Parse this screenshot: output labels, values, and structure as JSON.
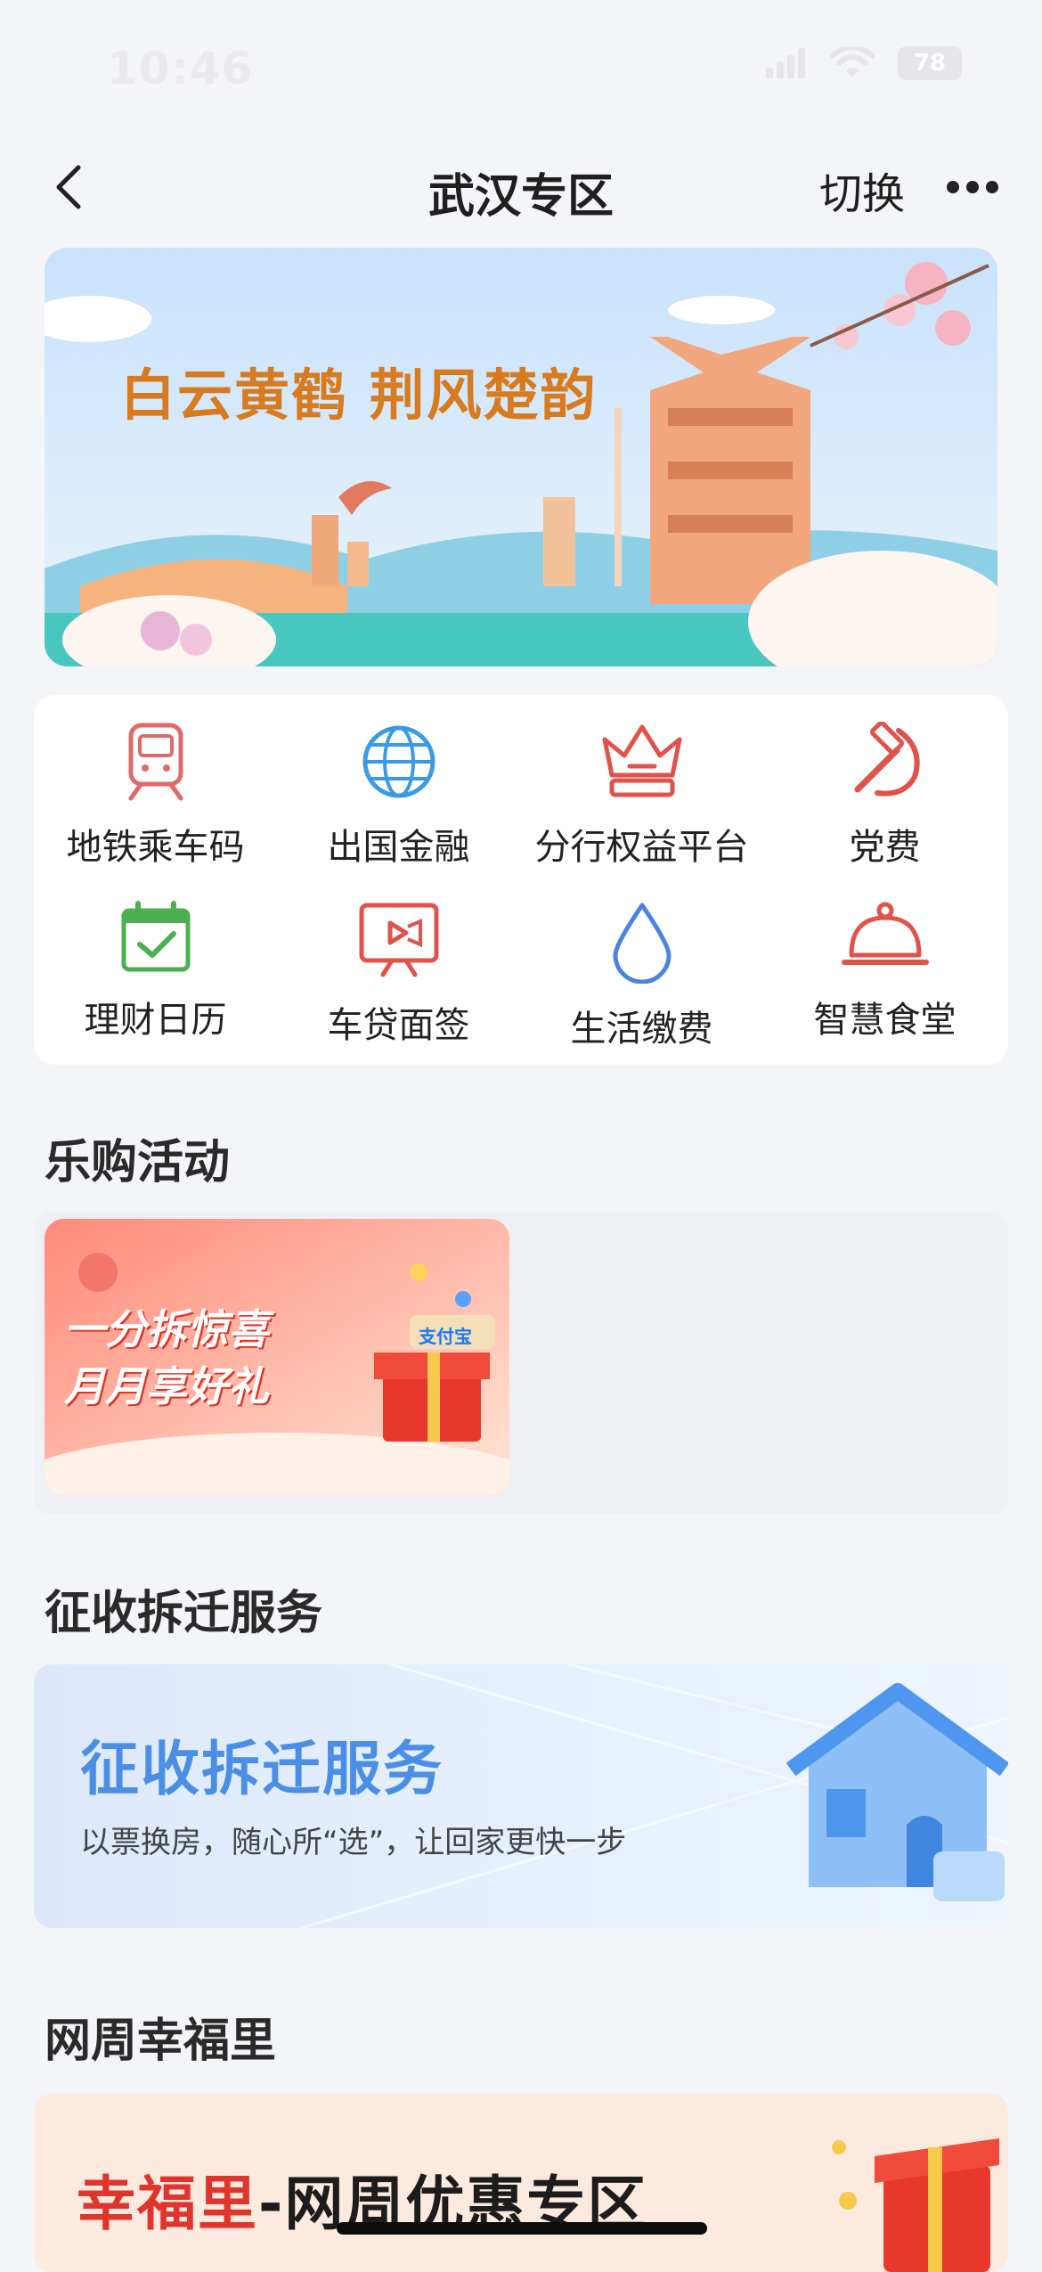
{
  "status": {
    "time": "10:46",
    "battery": "78"
  },
  "nav": {
    "title": "武汉专区",
    "switch_label": "切换"
  },
  "banner": {
    "title": "白云黄鹤 荆风楚韵"
  },
  "services": [
    {
      "label": "地铁乘车码",
      "icon": "metro-train-icon"
    },
    {
      "label": "出国金融",
      "icon": "globe-icon"
    },
    {
      "label": "分行权益平台",
      "icon": "crown-icon"
    },
    {
      "label": "党费",
      "icon": "hammer-sickle-icon"
    },
    {
      "label": "理财日历",
      "icon": "calendar-check-icon"
    },
    {
      "label": "车贷面签",
      "icon": "video-call-icon"
    },
    {
      "label": "生活缴费",
      "icon": "water-drop-icon"
    },
    {
      "label": "智慧食堂",
      "icon": "dish-cloche-icon"
    }
  ],
  "sections": {
    "shopping": "乐购活动",
    "relocation": "征收拆迁服务",
    "happiness": "网周幸福里"
  },
  "activity": {
    "line1": "一分拆惊喜",
    "line2": "月月享好礼",
    "badge": "支付宝"
  },
  "relocation_card": {
    "title": "征收拆迁服务",
    "subtitle": "以票换房，随心所“选”，让回家更快一步"
  },
  "happy_card": {
    "title_red": "幸福里",
    "dash": "-",
    "title_dark": "网周优惠专区"
  },
  "colors": {
    "accent_red": "#e0352c",
    "blue": "#4a8ee6",
    "green": "#4caf50",
    "banner_gold": "#d87a1e"
  }
}
